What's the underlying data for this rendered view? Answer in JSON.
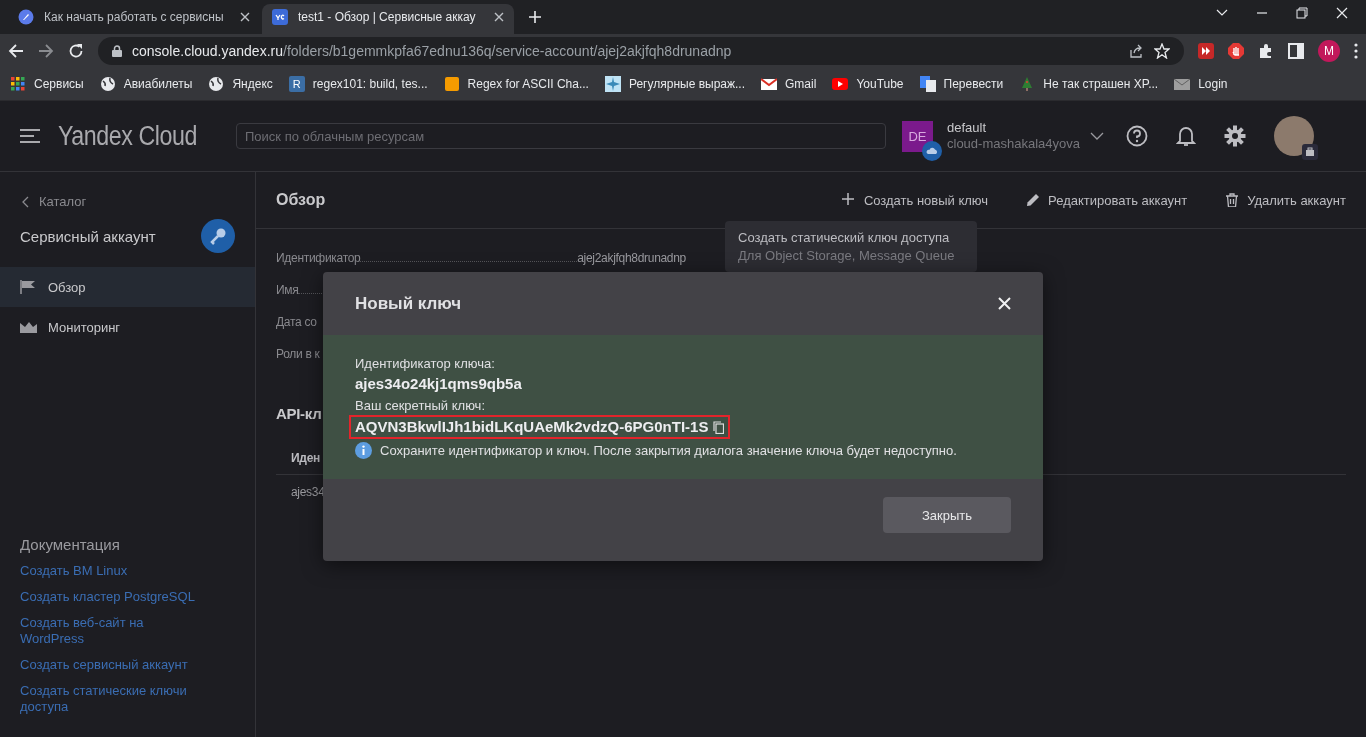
{
  "browser": {
    "tabs": [
      {
        "title": "Как начать работать с сервисны",
        "selected": false
      },
      {
        "title": "test1 - Обзор | Сервисные аккау",
        "selected": true
      }
    ],
    "address": {
      "host": "console.cloud.yandex.ru",
      "path": "/folders/b1gemmkpfa67ednu136q/service-account/ajej2akjfqh8drunadnp"
    },
    "profile_initial": "M",
    "bookmarks": [
      {
        "label": "Сервисы",
        "kind": "grid"
      },
      {
        "label": "Авиабилеты",
        "kind": "globe"
      },
      {
        "label": "Яндекс",
        "kind": "globe"
      },
      {
        "label": "regex101: build, tes...",
        "kind": "letter",
        "icon_text": "R"
      },
      {
        "label": "Regex for ASCII Cha...",
        "kind": "square"
      },
      {
        "label": "Регулярные выраж...",
        "kind": "burst"
      },
      {
        "label": "Gmail",
        "kind": "mail"
      },
      {
        "label": "YouTube",
        "kind": "play"
      },
      {
        "label": "Перевести",
        "kind": "translate"
      },
      {
        "label": "Не так страшен XP...",
        "kind": "tree"
      },
      {
        "label": "Login",
        "kind": "envelope"
      }
    ]
  },
  "header": {
    "logo": "Yandex Cloud",
    "search": {
      "placeholder": "Поиск по облачным ресурсам"
    },
    "folder": {
      "badge": "DE",
      "name": "default",
      "cloud": "cloud-mashakala4yova"
    }
  },
  "sidebar": {
    "back": "Каталог",
    "title": "Сервисный аккаунт",
    "items": [
      {
        "label": "Обзор",
        "kind": "flag",
        "selected": true
      },
      {
        "label": "Мониторинг",
        "kind": "chart",
        "selected": false
      }
    ],
    "docs_title": "Документация",
    "docs": [
      "Создать ВМ Linux",
      "Создать кластер PostgreSQL",
      "Создать веб-сайт на WordPress",
      "Создать сервисный аккаунт",
      "Создать статические ключи доступа"
    ]
  },
  "page": {
    "title": "Обзор",
    "actions": [
      {
        "label": "Создать новый ключ",
        "kind": "plus"
      },
      {
        "label": "Редактировать аккаунт",
        "kind": "edit"
      },
      {
        "label": "Удалить аккаунт",
        "kind": "delete"
      }
    ],
    "tooltip": {
      "title": "Создать статический ключ доступа",
      "text": "Для Object Storage, Message Queue"
    },
    "fields": [
      {
        "label": "Идентификатор",
        "value": "ajej2akjfqh8drunadnp"
      },
      {
        "label": "Имя"
      },
      {
        "label": "Дата со"
      },
      {
        "label": "Роли в к"
      }
    ],
    "section_title": "API-кл",
    "table": {
      "columns": [
        "Иден"
      ],
      "rows": [
        [
          "ajes34"
        ]
      ]
    }
  },
  "dialog": {
    "title": "Новый ключ",
    "key_id_label": "Идентификатор ключа:",
    "key_id": "ajes34o24kj1qms9qb5a",
    "secret_label": "Ваш секретный ключ:",
    "secret": "AQVN3BkwlIJh1bidLKqUAeMk2vdzQ-6PG0nTI-1S",
    "secret_highlighted": true,
    "notice": "Сохраните идентификатор и ключ. После закрытия диалога значение ключа будет недоступно.",
    "buttons": [
      "Закрыть"
    ]
  }
}
